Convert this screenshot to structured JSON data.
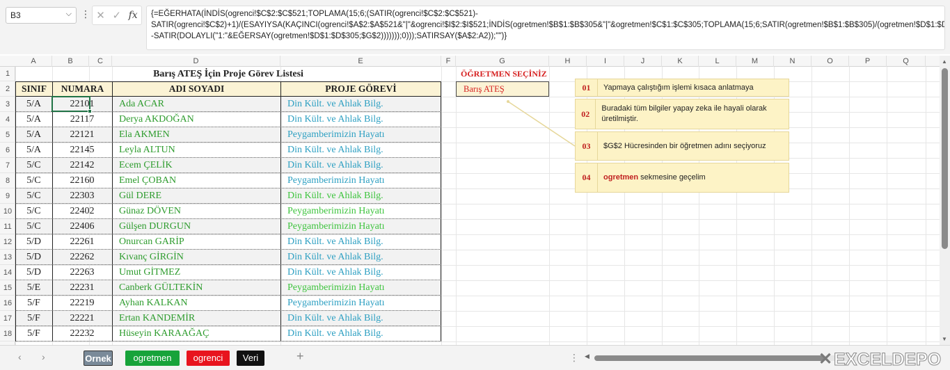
{
  "formula_bar": {
    "cell_ref": "B3",
    "formula": "{=EĞERHATA(İNDİS(ogrenci!$C$2:$C$521;TOPLAMA(15;6;(SATIR(ogrenci!$C$2:$C$521)-SATIR(ogrenci!$C$2)+1)/(ESAYIYSA(KAÇINCI(ogrenci!$A$2:$A$521&\"|\"&ogrenci!$I$2:$I$521;İNDİS(ogretmen!$B$1:$B$305&\"|\"&ogretmen!$C$1:$C$305;TOPLAMA(15;6;SATIR(ogretmen!$B$1:$B$305)/(ogretmen!$D$1:$D$305=$G$2);EĞER(1;--SATIR(DOLAYLI(\"1:\"&EĞERSAY(ogretmen!$D$1:$D$305;$G$2)))))));0)));SATIRSAY($A$2:A2));\"\")}",
    "fx_label": "fx"
  },
  "columns": [
    "A",
    "B",
    "C",
    "D",
    "E",
    "F",
    "G",
    "H",
    "I",
    "J",
    "K",
    "L",
    "M",
    "N",
    "O",
    "P",
    "Q"
  ],
  "row_numbers": [
    "1",
    "2",
    "3",
    "4",
    "5",
    "6",
    "7",
    "8",
    "9",
    "10",
    "11",
    "12",
    "13",
    "14",
    "15",
    "16",
    "17",
    "18"
  ],
  "sheet": {
    "title": "Barış ATEŞ İçin Proje Görev Listesi",
    "headers": {
      "sinif": "SINIF",
      "numara": "NUMARA",
      "adi_soyadi": "ADI SOYADI",
      "proje_gorevi": "PROJE GÖREVİ"
    },
    "rows": [
      {
        "sinif": "5/A",
        "numara": "22101",
        "ad": "Ada ACAR",
        "gorev": "Din Kült. ve Ahlak Bilg."
      },
      {
        "sinif": "5/A",
        "numara": "22117",
        "ad": "Derya AKDOĞAN",
        "gorev": "Din Kült. ve Ahlak Bilg."
      },
      {
        "sinif": "5/A",
        "numara": "22121",
        "ad": "Ela AKMEN",
        "gorev": "Peygamberimizin Hayatı"
      },
      {
        "sinif": "5/A",
        "numara": "22145",
        "ad": "Leyla ALTUN",
        "gorev": "Din Kült. ve Ahlak Bilg."
      },
      {
        "sinif": "5/C",
        "numara": "22142",
        "ad": "Ecem ÇELİK",
        "gorev": "Din Kült. ve Ahlak Bilg."
      },
      {
        "sinif": "5/C",
        "numara": "22160",
        "ad": "Emel ÇOBAN",
        "gorev": "Peygamberimizin Hayatı"
      },
      {
        "sinif": "5/C",
        "numara": "22303",
        "ad": "Gül DERE",
        "gorev": "Din Kült. ve Ahlak Bilg."
      },
      {
        "sinif": "5/C",
        "numara": "22402",
        "ad": "Günaz DÖVEN",
        "gorev": "Peygamberimizin Hayatı"
      },
      {
        "sinif": "5/C",
        "numara": "22406",
        "ad": "Gülşen DURGUN",
        "gorev": "Peygamberimizin Hayatı"
      },
      {
        "sinif": "5/D",
        "numara": "22261",
        "ad": "Onurcan GARİP",
        "gorev": "Din Kült. ve Ahlak Bilg."
      },
      {
        "sinif": "5/D",
        "numara": "22262",
        "ad": "Kıvanç GİRGİN",
        "gorev": "Din Kült. ve Ahlak Bilg."
      },
      {
        "sinif": "5/D",
        "numara": "22263",
        "ad": "Umut GİTMEZ",
        "gorev": "Din Kült. ve Ahlak Bilg."
      },
      {
        "sinif": "5/E",
        "numara": "22231",
        "ad": "Canberk GÜLTEKİN",
        "gorev": "Peygamberimizin Hayatı"
      },
      {
        "sinif": "5/F",
        "numara": "22219",
        "ad": "Ayhan KALKAN",
        "gorev": "Peygamberimizin Hayatı"
      },
      {
        "sinif": "5/F",
        "numara": "22221",
        "ad": "Ertan KANDEMİR",
        "gorev": "Din Kült. ve Ahlak Bilg."
      },
      {
        "sinif": "5/F",
        "numara": "22232",
        "ad": "Hüseyin KARAAĞAÇ",
        "gorev": "Din Kült. ve Ahlak Bilg."
      }
    ],
    "teacher_label": "ÖĞRETMEN SEÇİNİZ",
    "teacher_value": "Barış ATEŞ"
  },
  "notes": [
    {
      "num": "01",
      "text": "Yapmaya çalıştığım işlemi kısaca anlatmaya"
    },
    {
      "num": "02",
      "text": "Buradaki tüm bilgiler yapay zeka ile hayali olarak üretilmiştir."
    },
    {
      "num": "03",
      "text": "$G$2 Hücresinden bir öğretmen adını seçiyoruz"
    },
    {
      "num": "04",
      "text_red": "ogretmen",
      "text": " sekmesine geçelim"
    }
  ],
  "tabs": {
    "ornek": "Ornek",
    "ogretmen": "ogretmen",
    "ogrenci": "ogrenci",
    "veri": "Veri"
  },
  "watermark": "EXCELDEPO",
  "colors": {
    "excel_green": "#217346",
    "header_fill": "#fbf3d5",
    "note_fill": "#fdf3c6",
    "teacher_red": "#d62020"
  }
}
